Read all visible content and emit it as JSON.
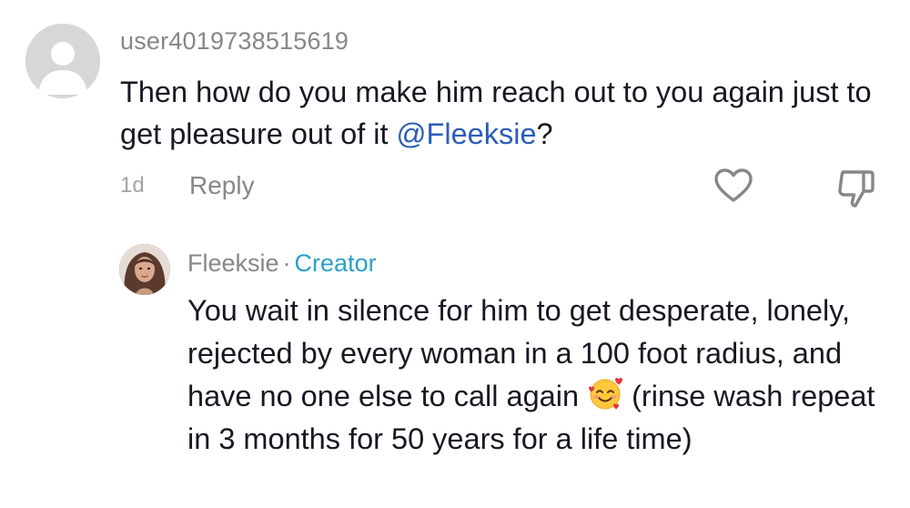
{
  "comment": {
    "username": "user4019738515619",
    "text_before_mention": "Then how do you make him reach out to you again just to get pleasure out of it ",
    "mention": "@Fleeksie",
    "text_after_mention": "?",
    "timestamp": "1d",
    "reply_label": "Reply",
    "icons": {
      "avatar": "default-user-avatar-icon",
      "like": "heart-outline-icon",
      "dislike": "thumbs-down-outline-icon"
    },
    "colors": {
      "mention": "#2b5db9",
      "meta_text": "#86878b"
    }
  },
  "reply": {
    "author": "Fleeksie",
    "separator": "·",
    "badge": "Creator",
    "text": "You wait in silence for him to get desperate, lonely, rejected by every woman in a 100 foot radius, and have no one else to call again",
    "emoji_name": "smiling-face-with-hearts-emoji",
    "text_continued": "(rinse wash repeat in 3 months for 50 years for a life time)",
    "colors": {
      "badge": "#2ba0c8"
    }
  }
}
